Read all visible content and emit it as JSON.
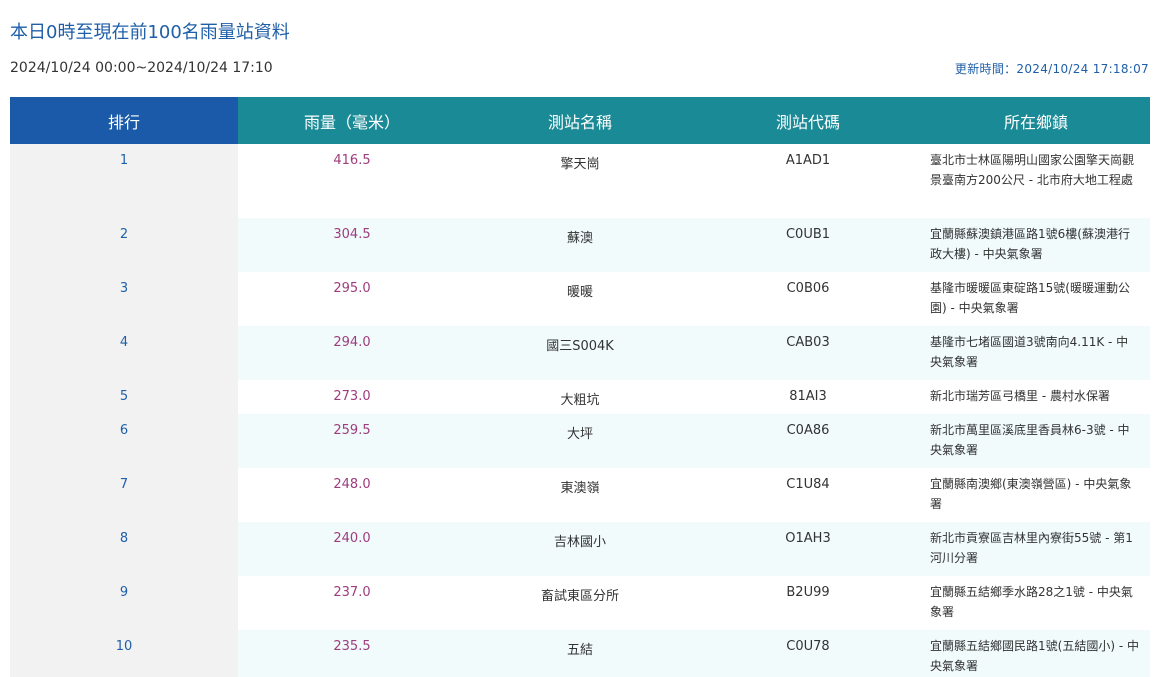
{
  "page": {
    "title": "本日0時至現在前100名雨量站資料",
    "time_range": "2024/10/24 00:00~2024/10/24 17:10",
    "updated": "更新時間：2024/10/24 17:18:07"
  },
  "table": {
    "headers": {
      "rank": "排行",
      "rainfall": "雨量（毫米）",
      "station_name": "測站名稱",
      "station_code": "測站代碼",
      "location": "所在鄉鎮"
    },
    "rows": [
      {
        "rank": "1",
        "rainfall": "416.5",
        "name": "擎天崗",
        "code": "A1AD1",
        "location": "臺北市士林區陽明山國家公園擎天崗觀景臺南方200公尺 - 北市府大地工程處"
      },
      {
        "rank": "2",
        "rainfall": "304.5",
        "name": "蘇澳",
        "code": "C0UB1",
        "location": "宜蘭縣蘇澳鎮港區路1號6樓(蘇澳港行政大樓) - 中央氣象署"
      },
      {
        "rank": "3",
        "rainfall": "295.0",
        "name": "暖暖",
        "code": "C0B06",
        "location": "基隆市暖暖區東碇路15號(暖暖運動公園) - 中央氣象署"
      },
      {
        "rank": "4",
        "rainfall": "294.0",
        "name": "國三S004K",
        "code": "CAB03",
        "location": "基隆市七堵區國道3號南向4.11K - 中央氣象署"
      },
      {
        "rank": "5",
        "rainfall": "273.0",
        "name": "大粗坑",
        "code": "81AI3",
        "location": "新北市瑞芳區弓橋里 - 農村水保署"
      },
      {
        "rank": "6",
        "rainfall": "259.5",
        "name": "大坪",
        "code": "C0A86",
        "location": "新北市萬里區溪底里香員林6-3號 - 中央氣象署"
      },
      {
        "rank": "7",
        "rainfall": "248.0",
        "name": "東澳嶺",
        "code": "C1U84",
        "location": "宜蘭縣南澳鄉(東澳嶺營區) - 中央氣象署"
      },
      {
        "rank": "8",
        "rainfall": "240.0",
        "name": "吉林國小",
        "code": "O1AH3",
        "location": "新北市貢寮區吉林里內寮街55號 - 第1河川分署"
      },
      {
        "rank": "9",
        "rainfall": "237.0",
        "name": "畜試東區分所",
        "code": "B2U99",
        "location": "宜蘭縣五結鄉季水路28之1號 - 中央氣象署"
      },
      {
        "rank": "10",
        "rainfall": "235.5",
        "name": "五結",
        "code": "C0U78",
        "location": "宜蘭縣五結鄉國民路1號(五結國小) - 中央氣象署"
      }
    ]
  }
}
